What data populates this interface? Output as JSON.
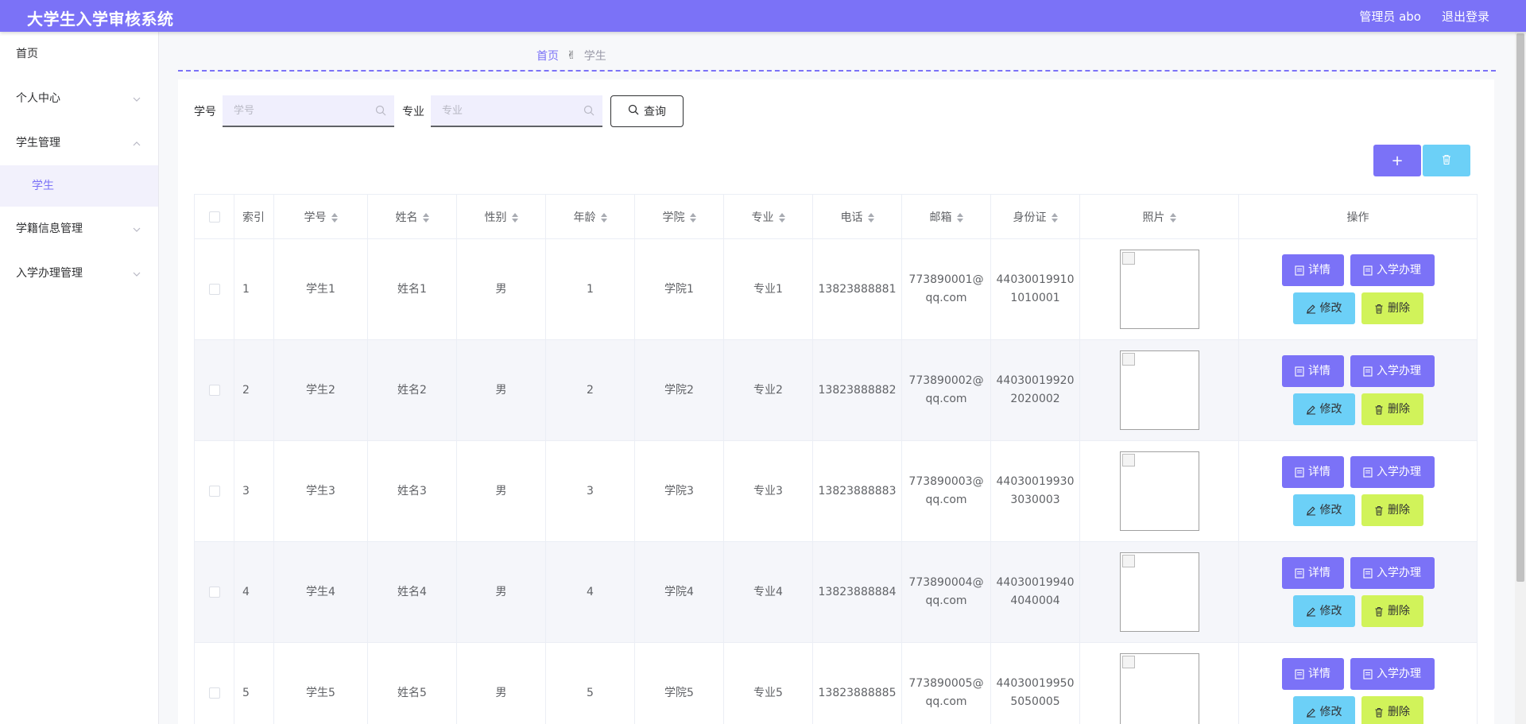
{
  "header": {
    "title": "大学生入学审核系统",
    "user_label": "管理员 abo",
    "logout_label": "退出登录"
  },
  "sidebar": {
    "items": [
      {
        "label": "首页"
      },
      {
        "label": "个人中心",
        "chevron": "chevron-down-icon"
      },
      {
        "label": "学生管理",
        "chevron": "chevron-up-icon"
      },
      {
        "label": "学生",
        "submenu": true
      },
      {
        "label": "学籍信息管理",
        "chevron": "chevron-down-icon"
      },
      {
        "label": "入学办理管理",
        "chevron": "chevron-down-icon"
      }
    ]
  },
  "breadcrumb": {
    "home": "首页",
    "separator": "✌",
    "current": "学生"
  },
  "search": {
    "student_no_label": "学号",
    "student_no_placeholder": "学号",
    "major_label": "专业",
    "major_placeholder": "专业",
    "query_label": "查询"
  },
  "toolbar": {
    "add_symbol": "+",
    "delete_icon": "trash-icon"
  },
  "table": {
    "headers": [
      "索引",
      "学号",
      "姓名",
      "性别",
      "年龄",
      "学院",
      "专业",
      "电话",
      "邮箱",
      "身份证",
      "照片",
      "操作"
    ],
    "rows": [
      {
        "index": "1",
        "student_no": "学生1",
        "name": "姓名1",
        "gender": "男",
        "age": "1",
        "college": "学院1",
        "major": "专业1",
        "phone": "13823888881",
        "email_1": "773890001@",
        "email_2": "qq.com",
        "id_1": "44030019910",
        "id_2": "1010001"
      },
      {
        "index": "2",
        "student_no": "学生2",
        "name": "姓名2",
        "gender": "男",
        "age": "2",
        "college": "学院2",
        "major": "专业2",
        "phone": "13823888882",
        "email_1": "773890002@",
        "email_2": "qq.com",
        "id_1": "44030019920",
        "id_2": "2020002"
      },
      {
        "index": "3",
        "student_no": "学生3",
        "name": "姓名3",
        "gender": "男",
        "age": "3",
        "college": "学院3",
        "major": "专业3",
        "phone": "13823888883",
        "email_1": "773890003@",
        "email_2": "qq.com",
        "id_1": "44030019930",
        "id_2": "3030003"
      },
      {
        "index": "4",
        "student_no": "学生4",
        "name": "姓名4",
        "gender": "男",
        "age": "4",
        "college": "学院4",
        "major": "专业4",
        "phone": "13823888884",
        "email_1": "773890004@",
        "email_2": "qq.com",
        "id_1": "44030019940",
        "id_2": "4040004"
      },
      {
        "index": "5",
        "student_no": "学生5",
        "name": "姓名5",
        "gender": "男",
        "age": "5",
        "college": "学院5",
        "major": "专业5",
        "phone": "13823888885",
        "email_1": "773890005@",
        "email_2": "qq.com",
        "id_1": "44030019950",
        "id_2": "5050005"
      }
    ],
    "actions": {
      "detail": "详情",
      "enroll": "入学办理",
      "edit": "修改",
      "delete": "删除"
    }
  },
  "colors": {
    "primary": "#7b72f7",
    "info": "#6cd0f7",
    "danger_lime": "#d1f35a"
  }
}
